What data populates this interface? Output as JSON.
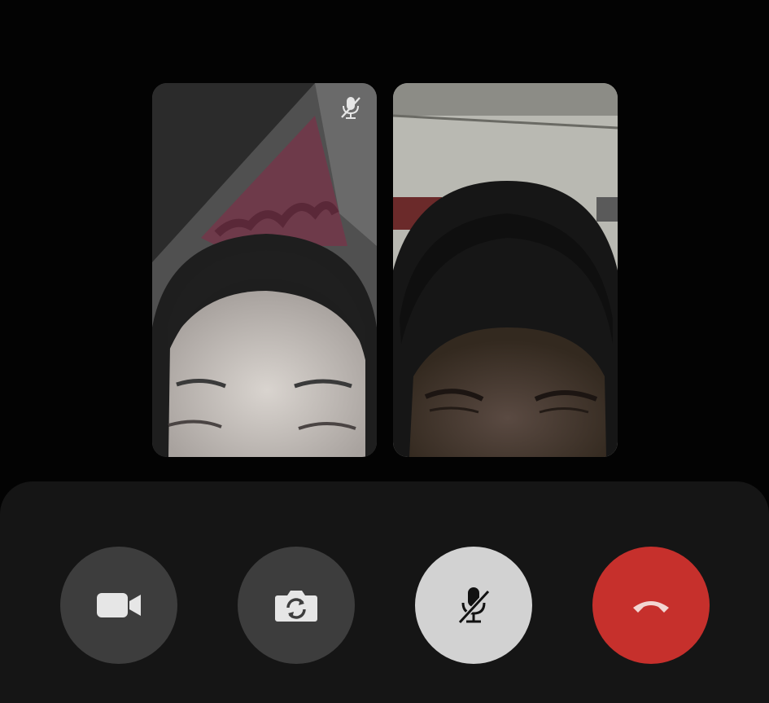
{
  "call": {
    "participants": [
      {
        "id": "remote",
        "muted": true
      },
      {
        "id": "self",
        "muted": false
      }
    ]
  },
  "controls": {
    "buttons": [
      {
        "id": "camera",
        "icon": "video-camera-icon",
        "bg": "#3d3d3d",
        "icon_color": "#e6e6e6"
      },
      {
        "id": "flip",
        "icon": "flip-camera-icon",
        "bg": "#3d3d3d",
        "icon_color": "#e6e6e6"
      },
      {
        "id": "mic",
        "icon": "microphone-off-icon",
        "bg": "#d2d2d2",
        "icon_color": "#111111",
        "active": true
      },
      {
        "id": "end",
        "icon": "phone-hangup-icon",
        "bg": "#c6302c",
        "icon_color": "#f2d6d2"
      }
    ]
  },
  "colors": {
    "background": "#030303",
    "panel": "#151515"
  }
}
